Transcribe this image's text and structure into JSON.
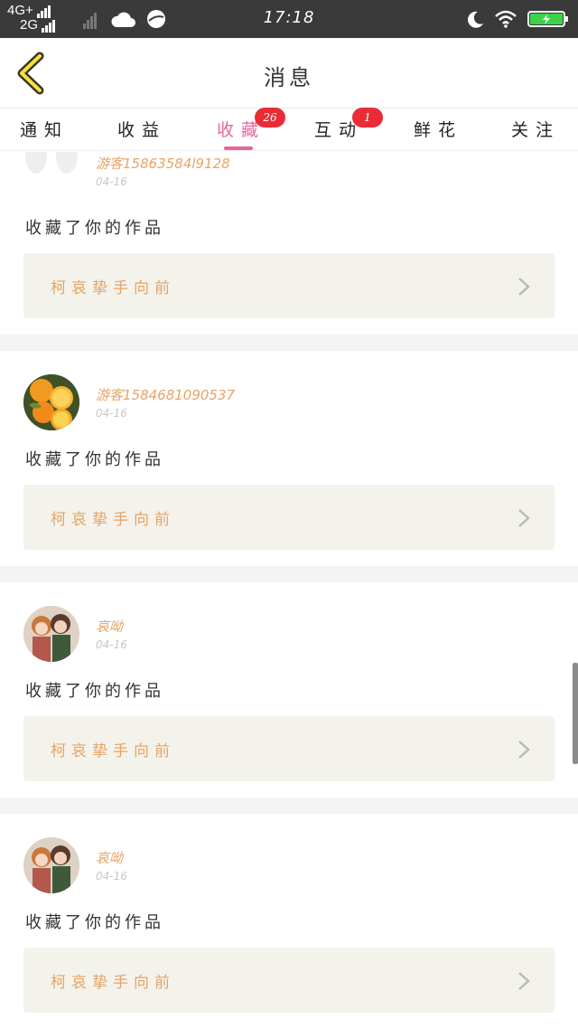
{
  "status_bar": {
    "network_top": "4G+",
    "network_bottom": "2G",
    "time": "17:18"
  },
  "header": {
    "title": "消息"
  },
  "tabs": [
    {
      "label": "通知",
      "badge": ""
    },
    {
      "label": "收益",
      "badge": ""
    },
    {
      "label": "收藏",
      "badge": "26",
      "active": true
    },
    {
      "label": "互动",
      "badge": "1"
    },
    {
      "label": "鲜花",
      "badge": ""
    },
    {
      "label": "关注",
      "badge": ""
    }
  ],
  "messages": [
    {
      "username": "游客15863584l9128",
      "time": "04-16",
      "text": "收藏了你的作品",
      "work_title": "柯哀挚手向前",
      "avatar": "blank"
    },
    {
      "username": "游客1584681090537",
      "time": "04-16",
      "text": "收藏了你的作品",
      "work_title": "柯哀挚手向前",
      "avatar": "orange"
    },
    {
      "username": "哀呦",
      "time": "04-16",
      "text": "收藏了你的作品",
      "work_title": "柯哀挚手向前",
      "avatar": "anime"
    },
    {
      "username": "哀呦",
      "time": "04-16",
      "text": "收藏了你的作品",
      "work_title": "柯哀挚手向前",
      "avatar": "anime"
    }
  ],
  "colors": {
    "accent": "#e7669d",
    "badge": "#e92c35",
    "username": "#e6a466",
    "work_box": "#f3f3ec"
  }
}
